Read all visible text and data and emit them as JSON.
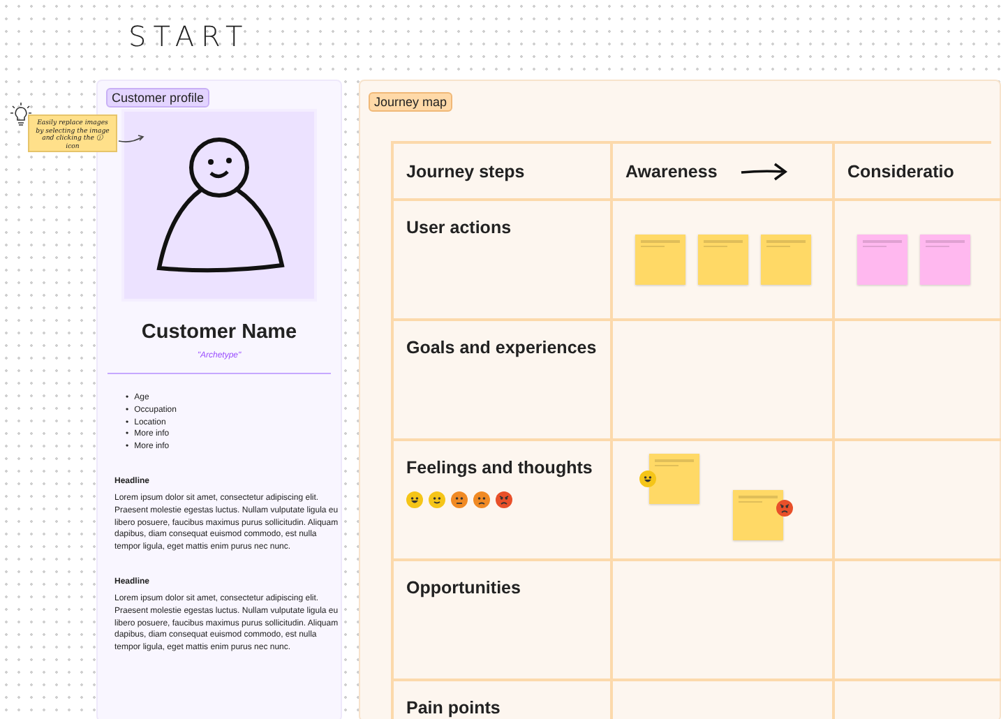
{
  "title": "START",
  "tip": {
    "text": "Easily replace images by selecting the image and clicking the ⓘ icon"
  },
  "profile": {
    "tag": "Customer profile",
    "name": "Customer Name",
    "archetype": "\"Archetype\"",
    "facts": [
      {
        "marker": "•",
        "text": "Age"
      },
      {
        "marker": "•",
        "text": "Occupation"
      },
      {
        "marker": "•",
        "text": "Location"
      },
      {
        "marker": "•",
        "text": "More info"
      },
      {
        "marker": "•",
        "text": "More info"
      }
    ],
    "sections": [
      {
        "headline": "Headline",
        "body": "Lorem ipsum dolor sit amet, consectetur adipiscing elit. Praesent molestie egestas luctus. Nullam vulputate ligula eu libero posuere, faucibus maximus purus sollicitudin. Aliquam dapibus, diam consequat euismod commodo, est nulla tempor ligula, eget mattis enim purus nec nunc."
      },
      {
        "headline": "Headline",
        "body": "Lorem ipsum dolor sit amet, consectetur adipiscing elit. Praesent molestie egestas luctus. Nullam vulputate ligula eu libero posuere, faucibus maximus purus sollicitudin. Aliquam dapibus, diam consequat euismod commodo, est nulla tempor ligula, eget mattis enim purus nec nunc."
      }
    ]
  },
  "journey": {
    "tag": "Journey map",
    "columns": [
      {
        "label": "Journey steps",
        "arrow": false
      },
      {
        "label": "Awareness",
        "arrow": true
      },
      {
        "label": "Consideratio",
        "arrow": false
      }
    ],
    "rows": [
      {
        "label": "User actions",
        "cells": [
          {
            "notes": [
              {
                "color": "#ffd966"
              },
              {
                "color": "#ffd966"
              },
              {
                "color": "#ffd966"
              }
            ]
          },
          {
            "notes": [
              {
                "color": "#ffb8ef"
              },
              {
                "color": "#ffb8ef"
              }
            ]
          }
        ]
      },
      {
        "label": "Goals and experiences"
      },
      {
        "label": "Feelings and thoughts",
        "emojis": [
          {
            "kind": "grin",
            "color": "#f5c518"
          },
          {
            "kind": "smile",
            "color": "#f5c518"
          },
          {
            "kind": "frown",
            "color": "#f08a24"
          },
          {
            "kind": "sad",
            "color": "#f08a24"
          },
          {
            "kind": "angry",
            "color": "#e8502a"
          }
        ],
        "cells": [
          {
            "notes": [
              {
                "color": "#ffd966",
                "emoji": {
                  "kind": "grin",
                  "color": "#f5c518"
                }
              },
              {
                "color": "#ffd966",
                "emoji": {
                  "kind": "angry",
                  "color": "#e8502a"
                }
              }
            ]
          }
        ]
      },
      {
        "label": "Opportunities"
      },
      {
        "label": "Pain points"
      }
    ]
  }
}
